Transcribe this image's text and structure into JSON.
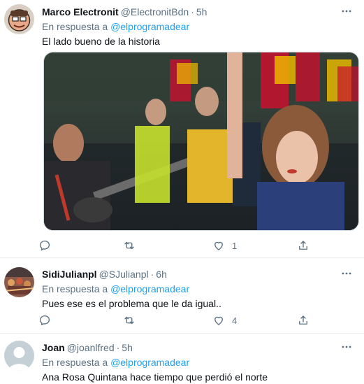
{
  "tweets": [
    {
      "name": "Marco Electronit",
      "handle": "@ElectronitBdn",
      "time": "5h",
      "reply_prefix": "En respuesta a",
      "reply_mention": "@elprogramadear",
      "text": "El lado bueno de la historia",
      "has_media": true,
      "reply_count": "",
      "retweet_count": "",
      "like_count": "1"
    },
    {
      "name": "SidiJulianpl",
      "handle": "@SJulianpl",
      "time": "6h",
      "reply_prefix": "En respuesta a",
      "reply_mention": "@elprogramadear",
      "text": "Pues ese es el problema que le da igual..",
      "has_media": false,
      "reply_count": "",
      "retweet_count": "",
      "like_count": "4"
    },
    {
      "name": "Joan",
      "handle": "@joanlfred",
      "time": "5h",
      "reply_prefix": "En respuesta a",
      "reply_mention": "@elprogramadear",
      "text": "Ana Rosa Quintana hace tiempo que perdió el norte",
      "has_media": false
    }
  ],
  "colors": {
    "link": "#1da1f2",
    "secondary_text": "#5b7083",
    "divider": "#ebeef0"
  },
  "icons": [
    "more-icon",
    "reply-icon",
    "retweet-icon",
    "like-icon",
    "share-icon"
  ]
}
